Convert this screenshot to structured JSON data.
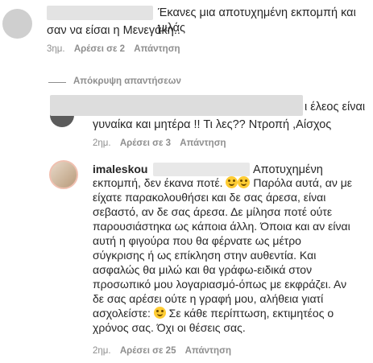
{
  "comment1": {
    "text_line1": "Έκανες μια αποτυχημένη εκπομπή και μιλάς",
    "text_line2": "σαν να είσαι η Μενεγάκη..",
    "time": "3ημ.",
    "likes": "Αρέσει σε 2",
    "reply": "Απάντηση"
  },
  "hide_replies": "Απόκρυψη απαντήσεων",
  "comment2": {
    "text_tail": "ι έλεος είναι",
    "text_line2": "γυναίκα και μητέρα !! Τι λες?? Ντροπή ,Αίσχος",
    "time": "2ημ.",
    "likes": "Αρέσει σε 3",
    "reply": "Απάντηση"
  },
  "comment3": {
    "username": "imaleskou",
    "line1_tail": "Αποτυχημένη",
    "line2a": "εκπομπή, δεν έκανα ποτέ.",
    "line2b": "Παρόλα αυτά, αν με",
    "line3": "είχατε παρακολουθήσει και δε σας άρεσα, είναι",
    "line4": "σεβαστό, αν δε σας άρεσα. Δε μίλησα ποτέ ούτε",
    "line5": "παρουσιάστηκα ως κάποια άλλη. Όποια και αν είναι",
    "line6": "αυτή η φιγούρα που θα φέρνατε ως μέτρο",
    "line7": "σύγκρισης ή ως επίκληση στην αυθεντία. Και",
    "line8": "ασφαλώς θα μιλώ και θα γράφω-ειδικά στον",
    "line9": "προσωπικό μου λογαριασμό-όπως με εκφράζει. Αν",
    "line10": "δε σας αρέσει ούτε η γραφή μου, αλήθεια γιατί",
    "line11a": "ασχολείστε:",
    "line11b": "Σε κάθε περίπτωση, εκτιμητέος ο",
    "line12": "χρόνος σας. Όχι οι θέσεις σας.",
    "time": "2ημ.",
    "likes": "Αρέσει σε 25",
    "reply": "Απάντηση"
  }
}
